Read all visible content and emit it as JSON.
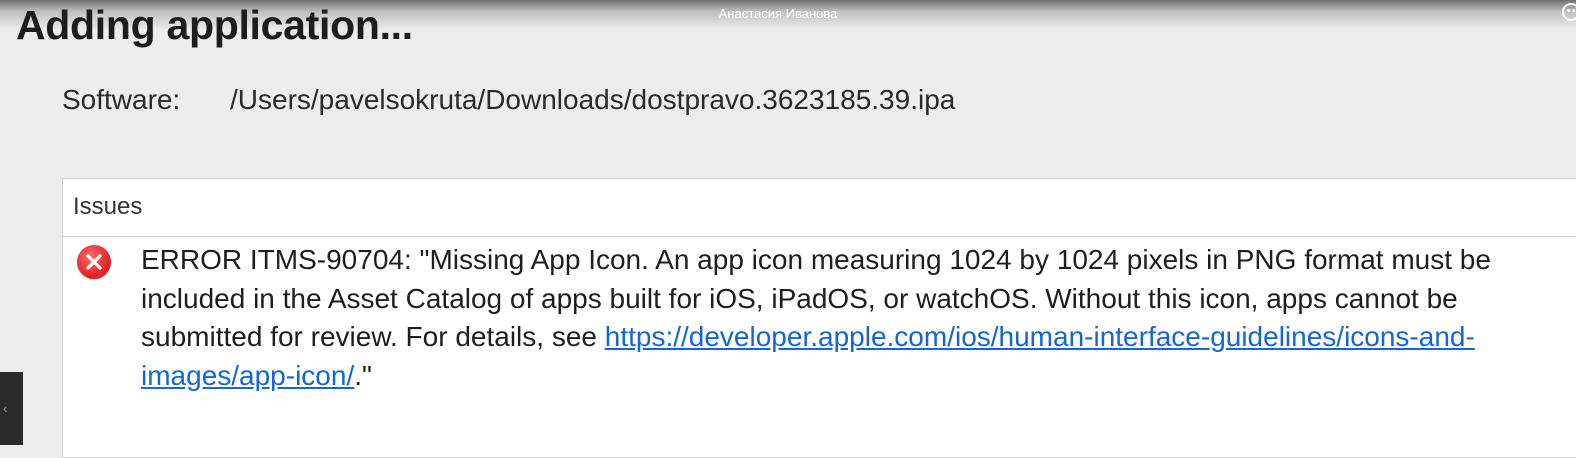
{
  "window": {
    "title": "Adding application...",
    "caller_name": "Анастасия Иванова"
  },
  "software": {
    "label": "Software:",
    "path": "/Users/pavelsokruta/Downloads/dostpravo.3623185.39.ipa"
  },
  "issues": {
    "header": "Issues",
    "items": [
      {
        "severity": "error",
        "icon": "error-icon",
        "text_before_link": "ERROR ITMS-90704: \"Missing App Icon. An app icon measuring 1024 by 1024 pixels in PNG format must be included in the Asset Catalog of apps built for iOS, iPadOS, or watchOS. Without this icon, apps cannot be submitted for review. For details, see ",
        "link": "https://developer.apple.com/ios/human-interface-guidelines/icons-and-images/app-icon/",
        "text_after_link": ".\""
      }
    ]
  },
  "colors": {
    "background": "#ececec",
    "error": "#e0282c",
    "link": "#1565d6"
  }
}
